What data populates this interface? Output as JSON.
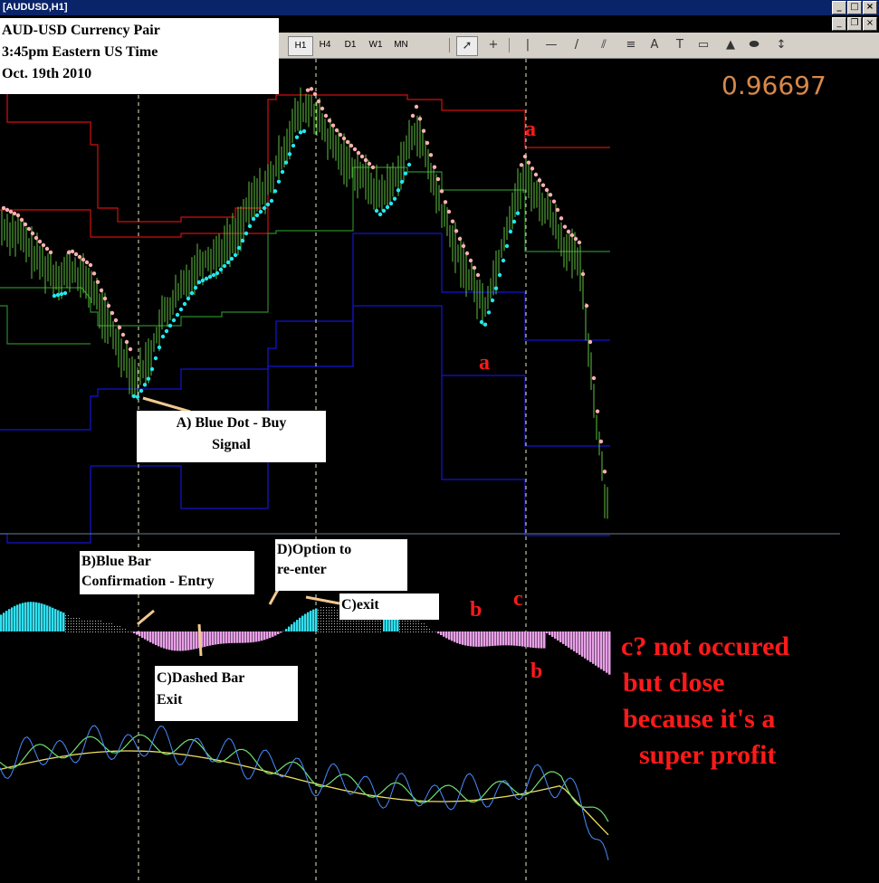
{
  "window": {
    "title": "[AUDUSD,H1]"
  },
  "toolbar": {
    "timeframes": [
      "H1",
      "H4",
      "D1",
      "W1",
      "MN"
    ],
    "active_timeframe": "H1",
    "tools": [
      "cursor-icon",
      "crosshair-icon",
      "vertical-line-icon",
      "horizontal-line-icon",
      "trendline-icon",
      "channel-icon",
      "fibonacci-icon",
      "text-icon",
      "label-icon",
      "rectangle-icon",
      "triangle-icon",
      "ellipse-icon",
      "arrows-icon"
    ]
  },
  "info_box": {
    "line1": "AUD-USD Currency Pair",
    "line2": "3:45pm Eastern US Time",
    "line3": "Oct. 19th 2010"
  },
  "current_price": "0.96697",
  "annotations": {
    "a_label": "A) Blue Dot - Buy",
    "a_label2": "Signal",
    "b_label": "B)Blue Bar",
    "b_label2": "Confirmation - Entry",
    "d_label": "D)Option to",
    "d_label2": "re-enter",
    "c_exit": "C)exit",
    "c_dashed": "C)Dashed Bar",
    "c_dashed2": "Exit",
    "letter_a": "a",
    "letter_b": "b",
    "letter_c": "c",
    "note1": "c? not occured",
    "note2": "but close",
    "note3": "because it's a",
    "note4": "super profit"
  },
  "colors": {
    "candle": "#5fc040",
    "upper_channel": "#d01010",
    "middle_channel": "#2a8a2a",
    "lower_channel": "#1414d0",
    "buy_dot": "#20e8f0",
    "sell_dot": "#ffb0b0",
    "hist_up": "#30e0f0",
    "hist_down": "#e8a0e8",
    "annotation_red": "#ff1a1a",
    "price_text": "#d7884a"
  }
}
